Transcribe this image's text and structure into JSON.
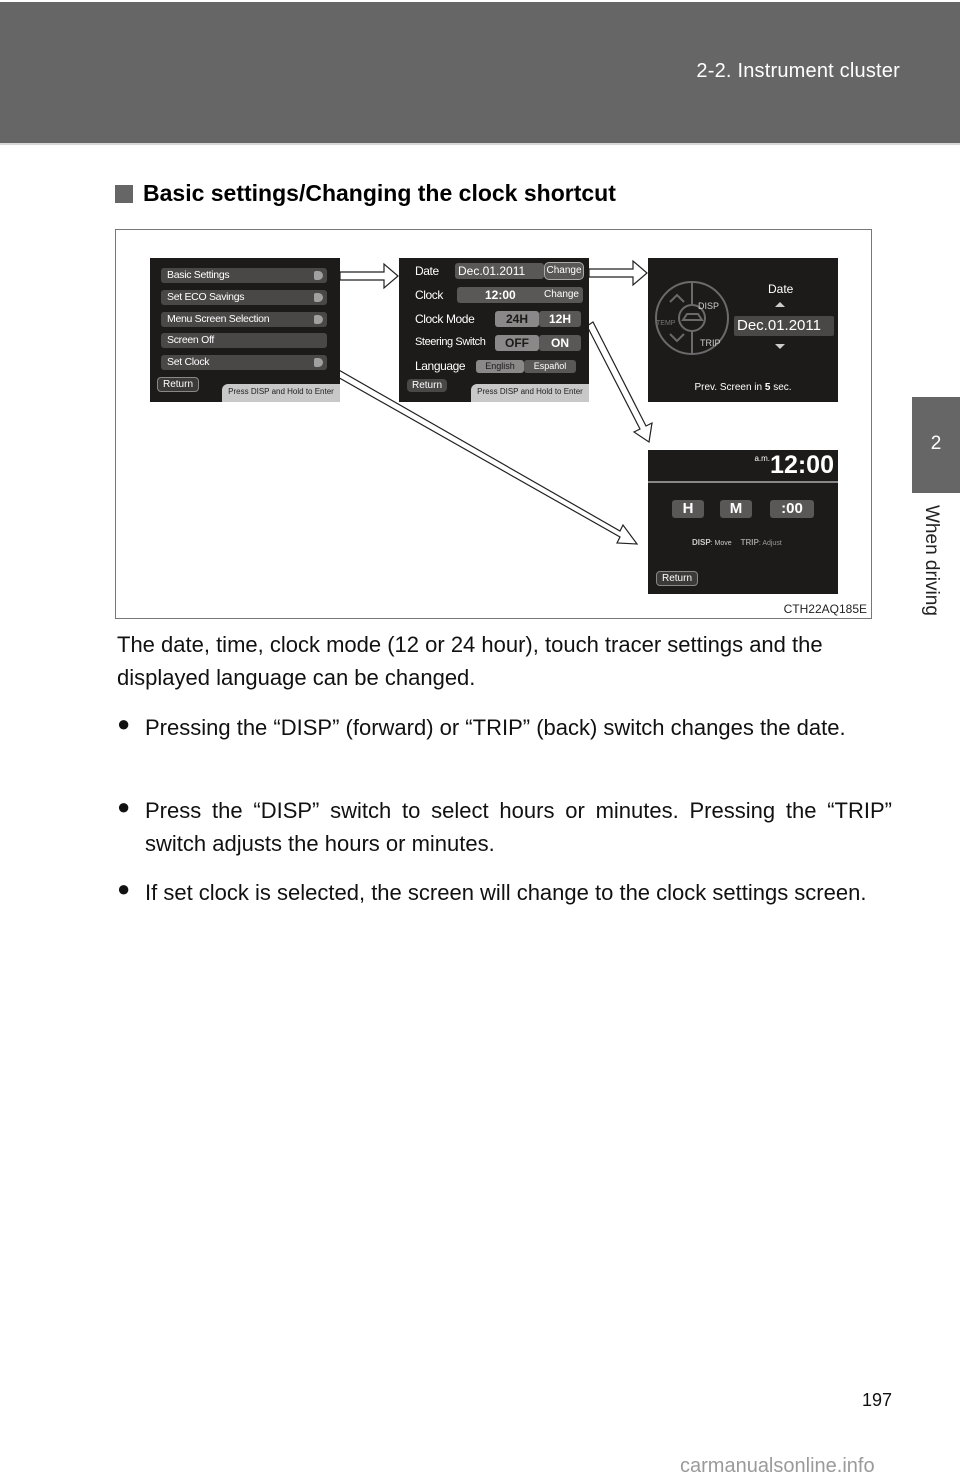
{
  "header": {
    "section_title": "2-2. Instrument cluster"
  },
  "side_tab": {
    "chapter_number": "2",
    "chapter_label": "When driving"
  },
  "heading": {
    "text": "Basic settings/Changing the clock shortcut"
  },
  "figure": {
    "caption_code": "CTH22AQ185E",
    "panel_menu": {
      "items": [
        "Basic Settings",
        "Set ECO Savings",
        "Menu Screen Selection",
        "Screen Off",
        "Set Clock"
      ],
      "items_with_arrow": [
        true,
        true,
        true,
        false,
        true
      ],
      "return_label": "Return",
      "hint": "Press DISP and Hold to Enter"
    },
    "panel_basic": {
      "date_label": "Date",
      "date_value": "Dec.01.2011",
      "date_change": "Change",
      "clock_label": "Clock",
      "clock_value": "12:00",
      "clock_change": "Change",
      "mode_label": "Clock Mode",
      "mode_options": [
        "24H",
        "12H"
      ],
      "mode_selected": "24H",
      "steering_label": "Steering Switch",
      "steering_options": [
        "OFF",
        "ON"
      ],
      "steering_selected": "OFF",
      "language_label": "Language",
      "language_options": [
        "English",
        "Español"
      ],
      "language_selected": "English",
      "return_label": "Return",
      "hint": "Press DISP and Hold to Enter"
    },
    "panel_date": {
      "title": "Date",
      "value": "Dec.01.2011",
      "dial_labels": {
        "disp": "DISP",
        "trip": "TRIP",
        "temp": "TEMP"
      },
      "footer_prefix": "Prev. Screen in ",
      "footer_seconds": "5",
      "footer_suffix": " sec."
    },
    "panel_clock": {
      "ampm": "a.m.",
      "time": "12:00",
      "fields": [
        "H",
        "M",
        ":00"
      ],
      "disp_key": "DISP",
      "disp_action": ": Move",
      "trip_key": "TRIP",
      "trip_action": ": Adjust",
      "return_label": "Return"
    }
  },
  "body": {
    "intro": "The date, time, clock mode (12 or 24 hour), touch tracer settings and the displayed language can be changed.",
    "bullets": [
      "Pressing the “DISP” (forward) or “TRIP” (back) switch changes the date.",
      "Press the “DISP” switch to select hours or minutes. Pressing the “TRIP” switch adjusts the hours or minutes.",
      "If set clock is selected, the screen will change to the clock settings screen."
    ],
    "bullet_glyph": "●"
  },
  "footer": {
    "page_number": "197",
    "watermark": "carmanualsonline.info"
  }
}
